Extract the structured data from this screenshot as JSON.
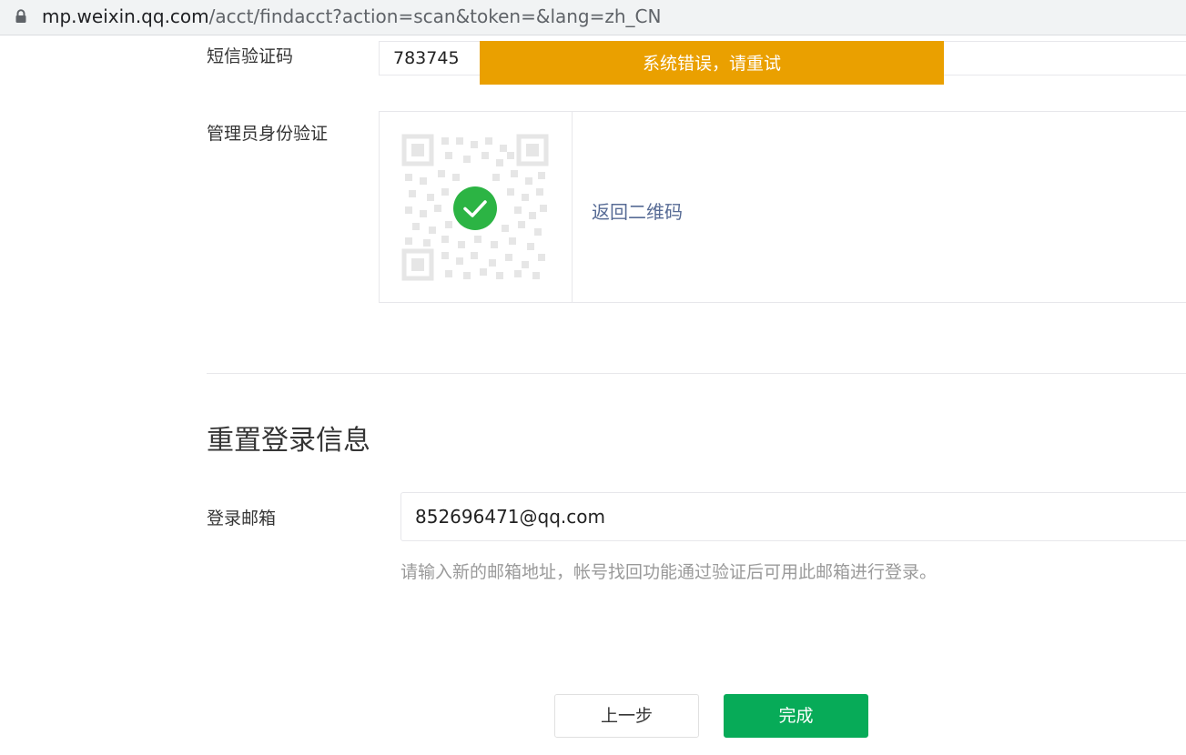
{
  "browser": {
    "url_host": "mp.weixin.qq.com",
    "url_path": "/acct/findacct?action=scan&token=&lang=zh_CN",
    "lock_icon": "lock-icon"
  },
  "verify": {
    "sms_label": "短信验证码",
    "sms_value": "783745",
    "toast_text": "系统错误，请重试",
    "admin_label": "管理员身份验证",
    "qr_icon": "qr-code-icon",
    "check_icon": "check-circle-icon",
    "back_link": "返回二维码"
  },
  "reset": {
    "title": "重置登录信息",
    "email_label": "登录邮箱",
    "email_value": "852696471@qq.com",
    "hint": "请输入新的邮箱地址，帐号找回功能通过验证后可用此邮箱进行登录。"
  },
  "actions": {
    "prev_label": "上一步",
    "done_label": "完成"
  },
  "colors": {
    "toast_bg": "#eaa000",
    "primary_green": "#07ab58",
    "check_green": "#2cb444",
    "link_blue": "#576b95"
  }
}
